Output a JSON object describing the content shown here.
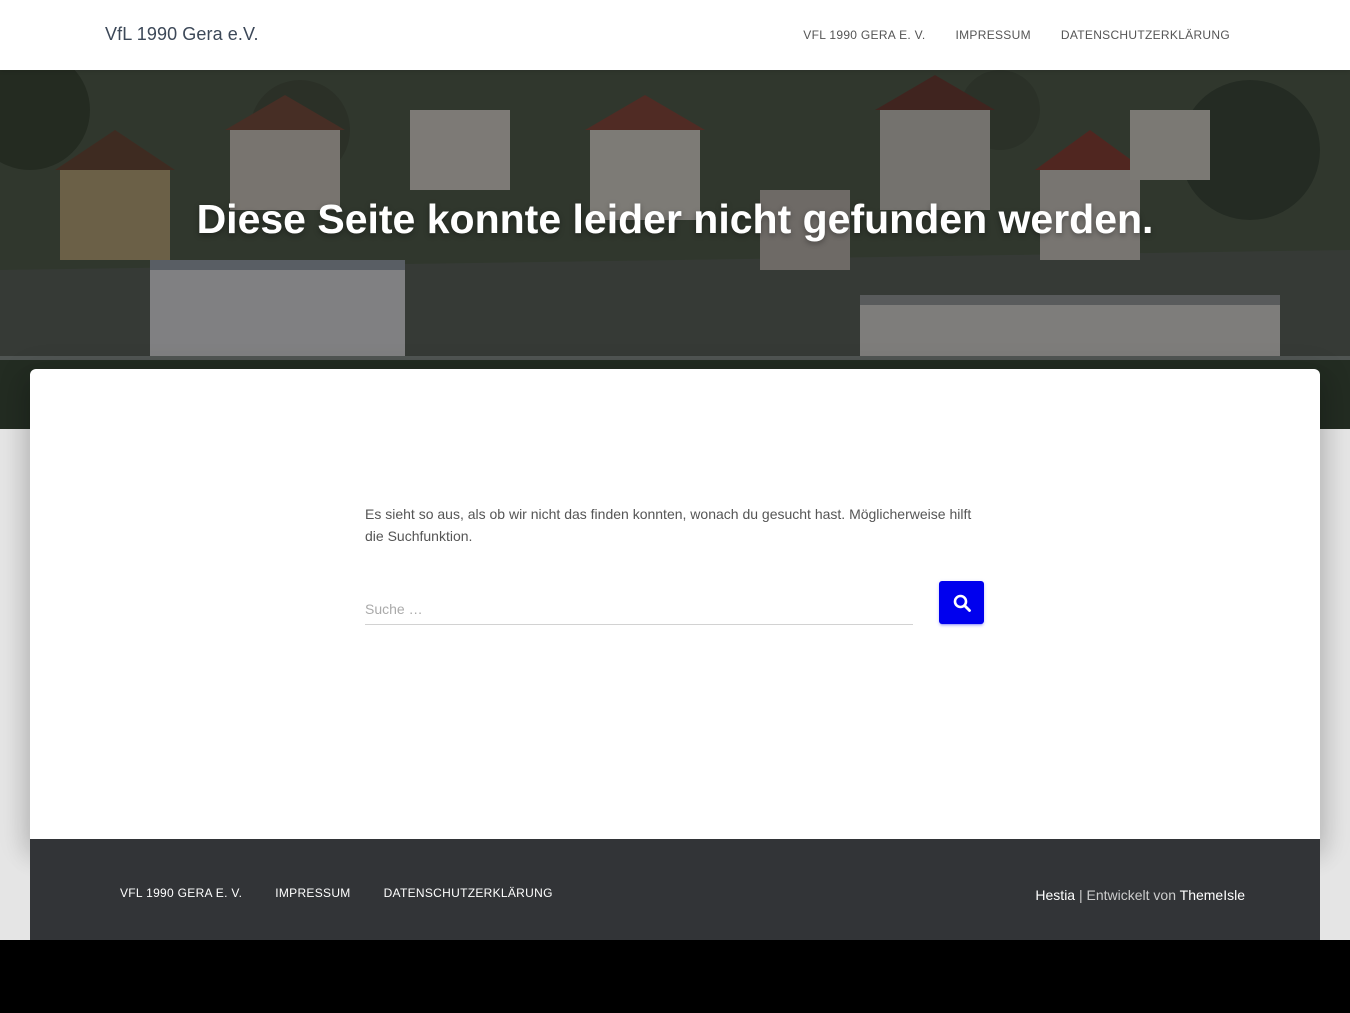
{
  "navbar": {
    "brand": "VfL 1990 Gera e.V.",
    "menu": [
      {
        "label": "VfL 1990 Gera e. V."
      },
      {
        "label": "Impressum"
      },
      {
        "label": "Datenschutzerklärung"
      }
    ]
  },
  "hero": {
    "title": "Diese Seite konnte leider nicht gefunden werden."
  },
  "main": {
    "message": "Es sieht so aus, als ob wir nicht das finden konnten, wonach du gesucht hast. Möglicherweise hilft die Suchfunktion.",
    "search": {
      "placeholder": "Suche …",
      "value": "",
      "button_icon": "search-icon"
    }
  },
  "footer": {
    "menu": [
      {
        "label": "VfL 1990 Gera e. V."
      },
      {
        "label": "Impressum"
      },
      {
        "label": "Datenschutzerklärung"
      }
    ],
    "copyright": {
      "theme": "Hestia",
      "separator": " | ",
      "developed_by": "Entwickelt von ",
      "author": "ThemeIsle"
    }
  },
  "colors": {
    "accent": "#0000ee",
    "footer_bg": "#323437",
    "text": "#555555"
  }
}
